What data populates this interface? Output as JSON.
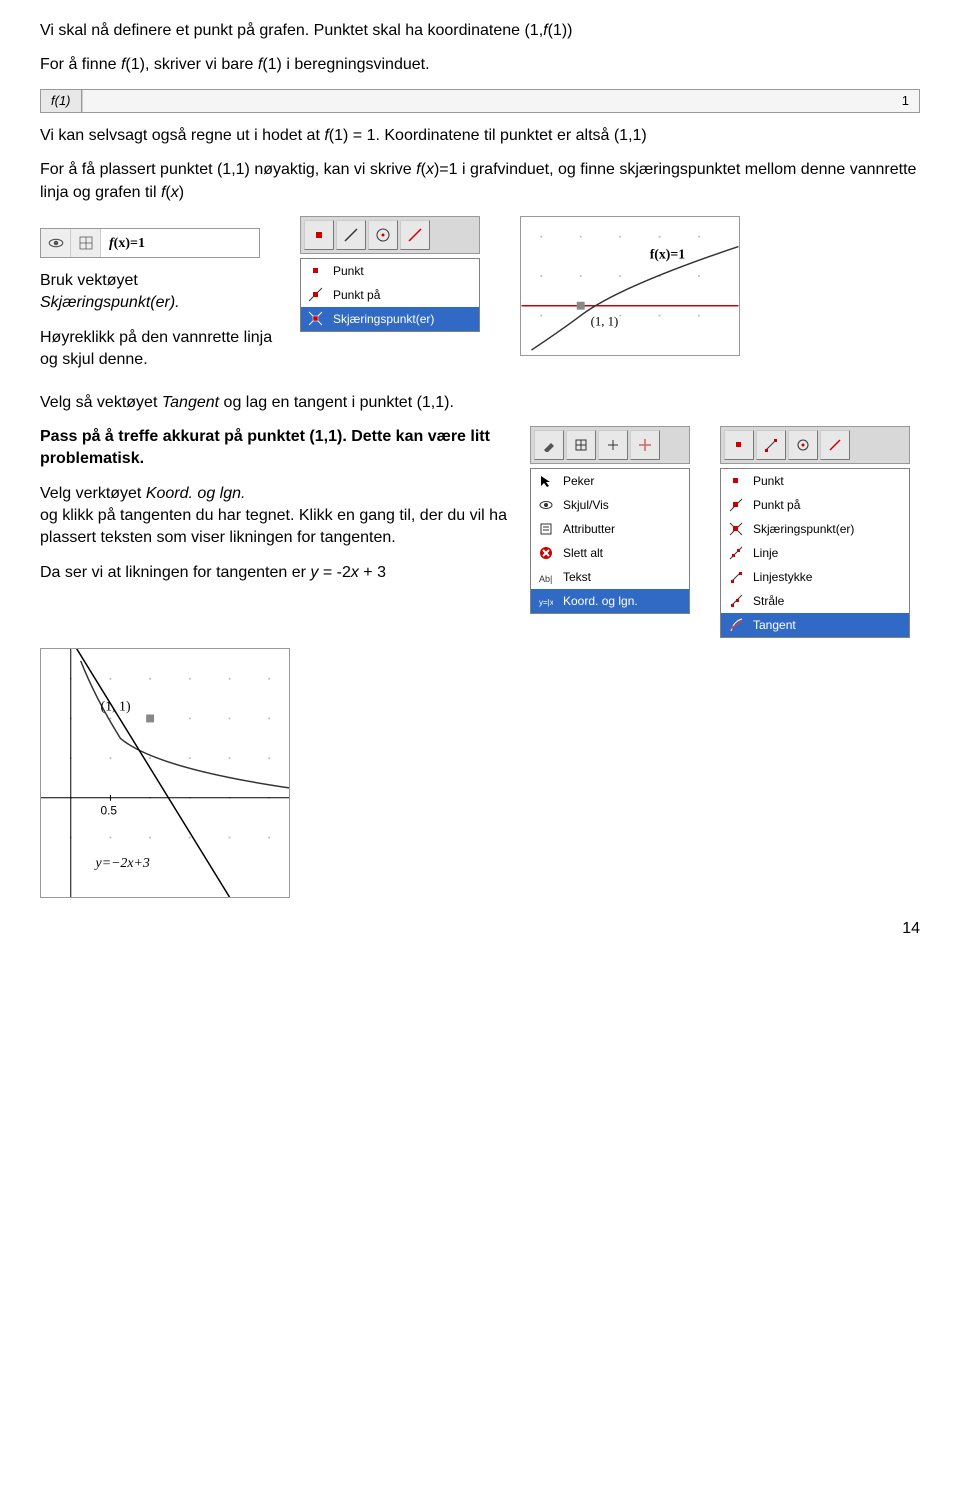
{
  "p1": "Vi skal nå definere et punkt på grafen. Punktet skal ha koordinatene (1,",
  "p1_fx": "f",
  "p1_end": "(1))",
  "p2a": "For å finne ",
  "p2b": "f",
  "p2c": "(1), skriver vi bare ",
  "p2d": "f",
  "p2e": "(1) i beregningsvinduet.",
  "cell1_label": "f(1)",
  "cell1_value": "1",
  "p3a": "Vi kan selvsagt også regne ut i hodet at ",
  "p3b": "f",
  "p3c": "(1) = 1. Koordinatene til punktet er altså (1,1)",
  "p4a": "For å få plassert punktet (1,1) nøyaktig, kan vi skrive ",
  "p4b": "f",
  "p4c": "(",
  "p4d": "x",
  "p4e": ")=1 i grafvinduet, og finne skjæringspunktet mellom denne vannrette linja og grafen til ",
  "p4f": "f",
  "p4g": "(",
  "p4h": "x",
  "p4i": ")",
  "input_fx": "f(x)=1",
  "menu1": {
    "item1": "Punkt",
    "item2": "Punkt på",
    "item3": "Skjæringspunkt(er)"
  },
  "graph1_label": "f(x)=1",
  "graph1_point": "(1, 1)",
  "p5a": "Bruk vektøyet ",
  "p5b": "Skjæringspunkt(er).",
  "p6": "Høyreklikk på den vannrette linja og skjul denne.",
  "p7a": "Velg så vektøyet ",
  "p7b": "Tangent",
  "p7c": " og lag en tangent i punktet (1,1).",
  "p8": "Pass på å treffe akkurat på punktet (1,1). Dette kan være litt problematisk.",
  "p9a": "Velg verktøyet ",
  "p9b": "Koord. og lgn.",
  "p9c": " og klikk på tangenten du har tegnet. Klikk en gang til, der du vil ha plassert teksten som viser likningen for tangenten.",
  "p10a": "Da ser vi at likningen for tangenten er ",
  "p10b": "y",
  "p10c": " = -2",
  "p10d": "x",
  "p10e": " + 3",
  "menu2": {
    "item1": "Peker",
    "item2": "Skjul/Vis",
    "item3": "Attributter",
    "item4": "Slett alt",
    "item5": "Tekst",
    "item6": "Koord. og lgn."
  },
  "menu3": {
    "item1": "Punkt",
    "item2": "Punkt på",
    "item3": "Skjæringspunkt(er)",
    "item4": "Linje",
    "item5": "Linjestykke",
    "item6": "Stråle",
    "item7": "Tangent"
  },
  "graph2_point": "(1, 1)",
  "graph2_tick": "0.5",
  "graph2_eq": "y=−2x+3",
  "page_num": "14"
}
